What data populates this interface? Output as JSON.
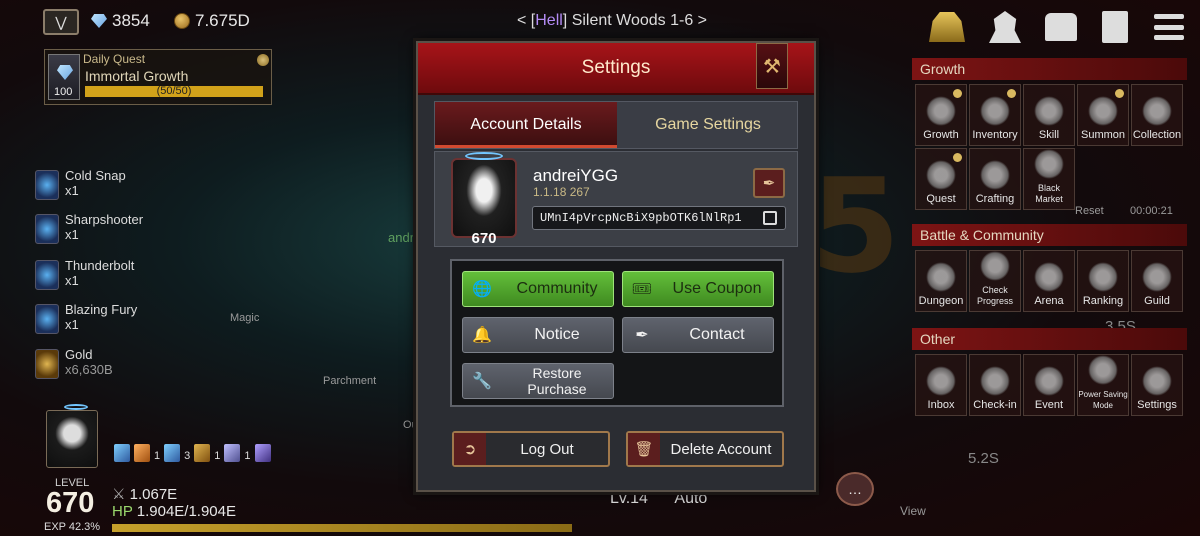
{
  "hud": {
    "gems": "3854",
    "gold": "7.675D",
    "stage_prefix": "< [",
    "stage_hell": "Hell",
    "stage_suffix": "] Silent Woods 1-6 >",
    "daily_quest": {
      "header": "Daily Quest",
      "name": "Immortal Growth",
      "level": "100",
      "progress": "(50/50)",
      "progress_fraction": 1.0
    }
  },
  "skills": [
    {
      "name": "Cold Snap",
      "count": "x1"
    },
    {
      "name": "Sharpshooter",
      "count": "x1"
    },
    {
      "name": "Thunderbolt",
      "count": "x1"
    },
    {
      "name": "Blazing Fury",
      "count": "x1"
    },
    {
      "name": "Gold",
      "count": "x6,630B"
    }
  ],
  "background_words": {
    "magic": "Magic",
    "parchment": "Parchment",
    "ou": "Ou",
    "andr": "andr",
    "reset": "Reset",
    "timer": "00:00:21",
    "val1": "3.5S",
    "val2": "5.2S"
  },
  "player": {
    "level_label": "LEVEL",
    "level": "670",
    "exp_label": "EXP",
    "exp_value": "42.3%",
    "attack": "1.067E",
    "hp_label": "HP",
    "hp_value": "1.904E/1.904E",
    "buffs": [
      "1",
      "3",
      "1",
      "1"
    ]
  },
  "right_panel": {
    "growth_title": "Growth",
    "growth_items": [
      "Growth",
      "Inventory",
      "Skill",
      "Summon",
      "Collection",
      "Quest",
      "Crafting",
      "Black Market"
    ],
    "battle_title": "Battle & Community",
    "battle_items": [
      "Dungeon",
      "Check Progress",
      "Arena",
      "Ranking",
      "Guild"
    ],
    "other_title": "Other",
    "other_items": [
      "Inbox",
      "Check-in",
      "Event",
      "Power Saving Mode",
      "Settings"
    ]
  },
  "modal": {
    "title": "Settings",
    "tabs": {
      "account": "Account Details",
      "game": "Game Settings"
    },
    "account": {
      "username": "andreiYGG",
      "version": "1.1.18 267",
      "uid": "UMnI4pVrcpNcBiX9pbOTK6lNlRp1",
      "avatar_level": "670"
    },
    "buttons": {
      "community": "Community",
      "use_coupon": "Use Coupon",
      "notice": "Notice",
      "contact": "Contact",
      "restore_purchase": "Restore Purchase",
      "log_out": "Log Out",
      "delete_account": "Delete Account"
    }
  },
  "bottom": {
    "level": "Lv.14",
    "auto": "Auto",
    "view": "View"
  }
}
